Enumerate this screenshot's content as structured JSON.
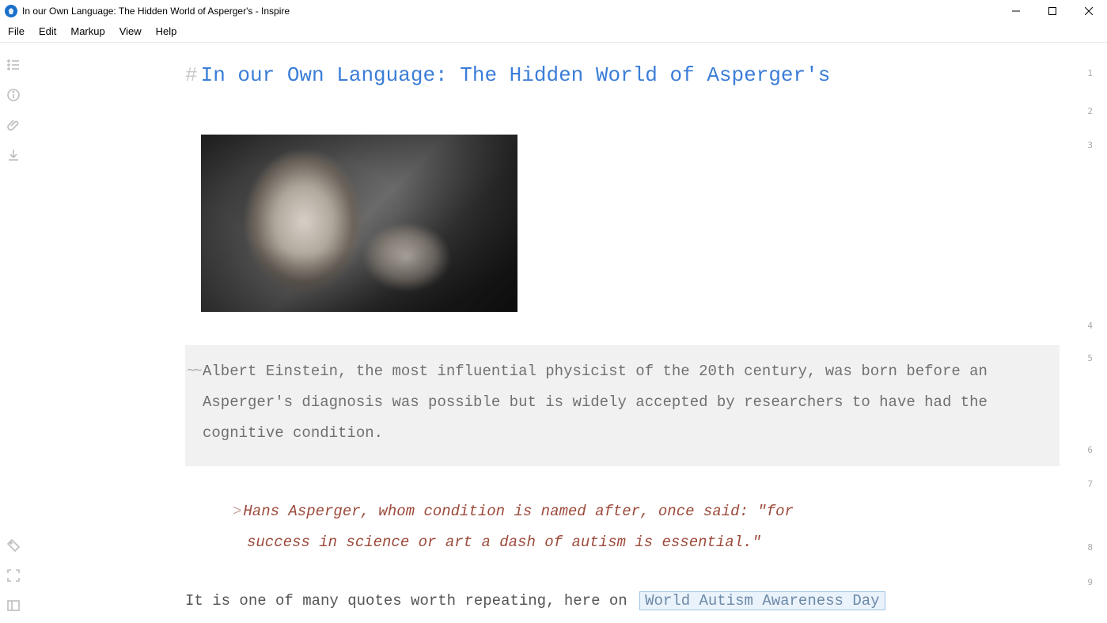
{
  "window": {
    "title": "In our Own Language: The Hidden World of Asperger's - Inspire"
  },
  "menu": {
    "file": "File",
    "edit": "Edit",
    "markup": "Markup",
    "view": "View",
    "help": "Help"
  },
  "toolbar": {
    "outline": "outline-icon",
    "info": "info-icon",
    "attach": "attachment-icon",
    "download": "download-icon",
    "tag": "tag-icon",
    "fullscreen": "fullscreen-icon",
    "panel": "panel-icon"
  },
  "lineNumbers": [
    "1",
    "2",
    "3",
    "4",
    "5",
    "6",
    "7",
    "8",
    "9"
  ],
  "doc": {
    "heading_marker": "#",
    "heading": "In our Own Language: The Hidden World of Asperger's",
    "image_alt": "Albert Einstein portrait",
    "strike_marker": "~~",
    "strike_text": "Albert Einstein, the most influential physicist of the 20th century, was born before an Asperger's diagnosis was possible but is widely accepted by researchers to have had the cognitive condition.",
    "quote_marker": ">",
    "quote_line1": "Hans Asperger, whom condition is named after, once said: \"for",
    "quote_line2": "success in science or art a dash of autism is essential.\"",
    "body_prefix": "It is one of many quotes worth repeating, here on ",
    "link_text": "World Autism Awareness Day"
  }
}
